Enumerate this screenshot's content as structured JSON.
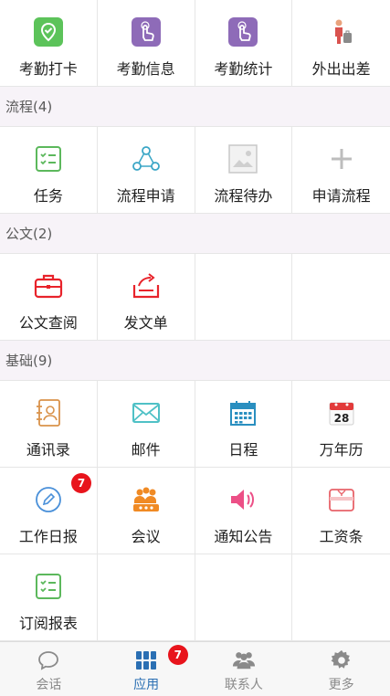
{
  "attendance": [
    {
      "label": "考勤打卡",
      "icon": "location-check-icon",
      "color": "#5cc35a"
    },
    {
      "label": "考勤信息",
      "icon": "touch-hand-icon",
      "color": "#8e6bb8"
    },
    {
      "label": "考勤统计",
      "icon": "touch-hand-icon",
      "color": "#8e6bb8"
    },
    {
      "label": "外出出差",
      "icon": "business-trip-icon",
      "color": "#d9534f"
    }
  ],
  "workflow": {
    "header": "流程(4)",
    "items": [
      {
        "label": "任务",
        "icon": "checklist-icon",
        "color": "#5cb85c"
      },
      {
        "label": "流程申请",
        "icon": "workflow-nodes-icon",
        "color": "#3aa6c6"
      },
      {
        "label": "流程待办",
        "icon": "image-placeholder-icon",
        "color": "#bdbdbd"
      },
      {
        "label": "申请流程",
        "icon": "plus-icon",
        "color": "#bdbdbd"
      }
    ]
  },
  "documents": {
    "header": "公文(2)",
    "items": [
      {
        "label": "公文查阅",
        "icon": "briefcase-icon",
        "color": "#e8232b"
      },
      {
        "label": "发文单",
        "icon": "outbox-icon",
        "color": "#e8232b"
      }
    ]
  },
  "basics": {
    "header": "基础(9)",
    "items": [
      {
        "label": "通讯录",
        "icon": "contacts-icon",
        "color": "#d9924a"
      },
      {
        "label": "邮件",
        "icon": "mail-icon",
        "color": "#4fc1c6"
      },
      {
        "label": "日程",
        "icon": "calendar-icon",
        "color": "#2a8fc0"
      },
      {
        "label": "万年历",
        "icon": "date-28-icon",
        "color": "#333333",
        "day": "28"
      },
      {
        "label": "工作日报",
        "icon": "pencil-circle-icon",
        "color": "#4a90d9",
        "badge": "7"
      },
      {
        "label": "会议",
        "icon": "meeting-icon",
        "color": "#f08a24"
      },
      {
        "label": "通知公告",
        "icon": "speaker-icon",
        "color": "#ec4f86"
      },
      {
        "label": "工资条",
        "icon": "payslip-icon",
        "color": "#e8636a"
      },
      {
        "label": "订阅报表",
        "icon": "checklist-icon",
        "color": "#5cb85c"
      }
    ]
  },
  "tabbar": [
    {
      "label": "会话",
      "icon": "chat-bubble-icon",
      "active": false
    },
    {
      "label": "应用",
      "icon": "apps-grid-icon",
      "active": true,
      "badge": "7"
    },
    {
      "label": "联系人",
      "icon": "people-icon",
      "active": false
    },
    {
      "label": "更多",
      "icon": "gear-icon",
      "active": false
    }
  ],
  "colors": {
    "active_tab": "#2a6fb3",
    "badge": "#e8141c",
    "section_bg": "#f7f3f8"
  }
}
